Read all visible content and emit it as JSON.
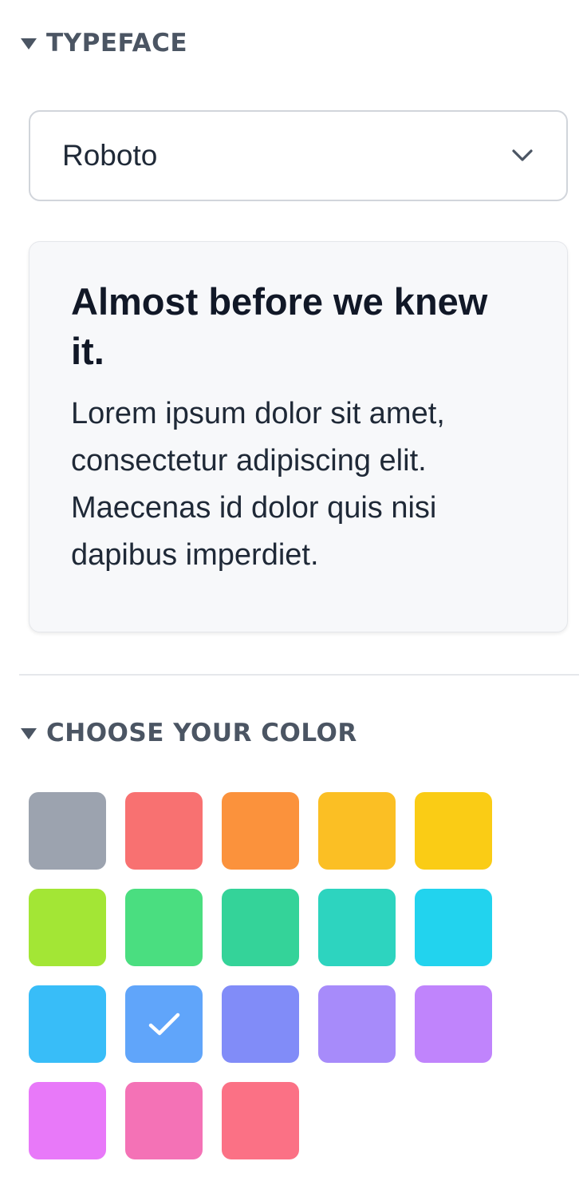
{
  "typeface_section": {
    "title": "TYPEFACE",
    "caret_icon": "triangle-down-icon",
    "select": {
      "value": "Roboto",
      "icon": "chevron-down-icon"
    },
    "preview": {
      "heading": "Almost before we knew it.",
      "body": "Lorem ipsum dolor sit amet, consectetur adipiscing elit. Maecenas id dolor quis nisi dapibus imperdiet."
    }
  },
  "color_section": {
    "title": "CHOOSE YOUR COLOR",
    "caret_icon": "triangle-down-icon",
    "selected_color": "blue",
    "swatches": [
      {
        "name": "gray",
        "color": "#9CA3AF"
      },
      {
        "name": "red",
        "color": "#F87171"
      },
      {
        "name": "orange",
        "color": "#FB923C"
      },
      {
        "name": "amber",
        "color": "#FBBF24"
      },
      {
        "name": "yellow",
        "color": "#FACC15"
      },
      {
        "name": "lime",
        "color": "#A3E635"
      },
      {
        "name": "green",
        "color": "#4ADE80"
      },
      {
        "name": "emerald",
        "color": "#34D399"
      },
      {
        "name": "teal",
        "color": "#2DD4BF"
      },
      {
        "name": "cyan",
        "color": "#22D3EE"
      },
      {
        "name": "sky",
        "color": "#38BDF8"
      },
      {
        "name": "blue",
        "color": "#60A5FA"
      },
      {
        "name": "indigo",
        "color": "#818CF8"
      },
      {
        "name": "violet",
        "color": "#A78BFA"
      },
      {
        "name": "purple",
        "color": "#C084FC"
      },
      {
        "name": "fuchsia",
        "color": "#E879F9"
      },
      {
        "name": "pink",
        "color": "#F472B6"
      },
      {
        "name": "rose",
        "color": "#FB7185"
      }
    ],
    "check_icon": "checkmark-icon"
  }
}
